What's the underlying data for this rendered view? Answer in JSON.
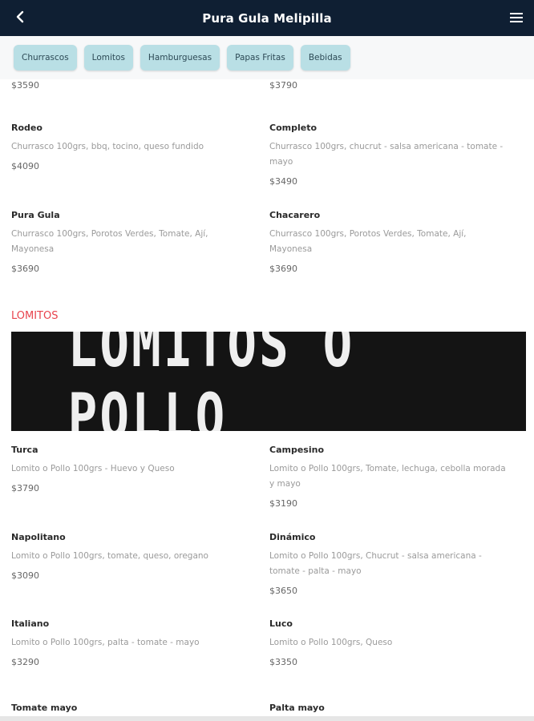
{
  "header": {
    "title": "Pura Gula Melipilla",
    "back_icon": "chevron-left-icon",
    "menu_icon": "hamburger-menu-icon"
  },
  "categories": [
    "Churrascos",
    "Lomitos",
    "Hamburguesas",
    "Papas Fritas",
    "Bebidas"
  ],
  "top_prices": {
    "left": "$3590",
    "right": "$3790"
  },
  "churrascos": [
    {
      "name": "Rodeo",
      "desc": "Churrasco 100grs, bbq, tocino, queso fundido",
      "price": "$4090"
    },
    {
      "name": "Completo",
      "desc": "Churrasco 100grs, chucrut - salsa americana - tomate - mayo",
      "price": "$3490"
    },
    {
      "name": "Pura Gula",
      "desc": "Churrasco 100grs, Porotos Verdes, Tomate, Ají, Mayonesa",
      "price": "$3690"
    },
    {
      "name": "Chacarero",
      "desc": "Churrasco 100grs, Porotos Verdes, Tomate, Ají, Mayonesa",
      "price": "$3690"
    }
  ],
  "lomitos_section": {
    "title": "LOMITOS",
    "banner_text": "LOMITOS O POLLO"
  },
  "lomitos": [
    {
      "name": "Turca",
      "desc": "Lomito o Pollo 100grs - Huevo y Queso",
      "price": "$3790"
    },
    {
      "name": "Campesino",
      "desc": "Lomito o Pollo 100grs, Tomate, lechuga, cebolla morada y mayo",
      "price": "$3190"
    },
    {
      "name": "Napolitano",
      "desc": "Lomito o Pollo 100grs, tomate, queso, oregano",
      "price": "$3090"
    },
    {
      "name": "Dinámico",
      "desc": "Lomito o Pollo 100grs, Chucrut - salsa americana - tomate - palta - mayo",
      "price": "$3650"
    },
    {
      "name": "Italiano",
      "desc": "Lomito o Pollo 100grs, palta - tomate - mayo",
      "price": "$3290"
    },
    {
      "name": "Luco",
      "desc": "Lomito o Pollo 100grs, Queso",
      "price": "$3350"
    },
    {
      "name": "Tomate mayo",
      "desc": "",
      "price": ""
    },
    {
      "name": "Palta mayo",
      "desc": "",
      "price": ""
    }
  ],
  "colors": {
    "header_bg": "#0f1f33",
    "chip_bg": "#b9dfe5",
    "section_title": "#e8434d"
  }
}
